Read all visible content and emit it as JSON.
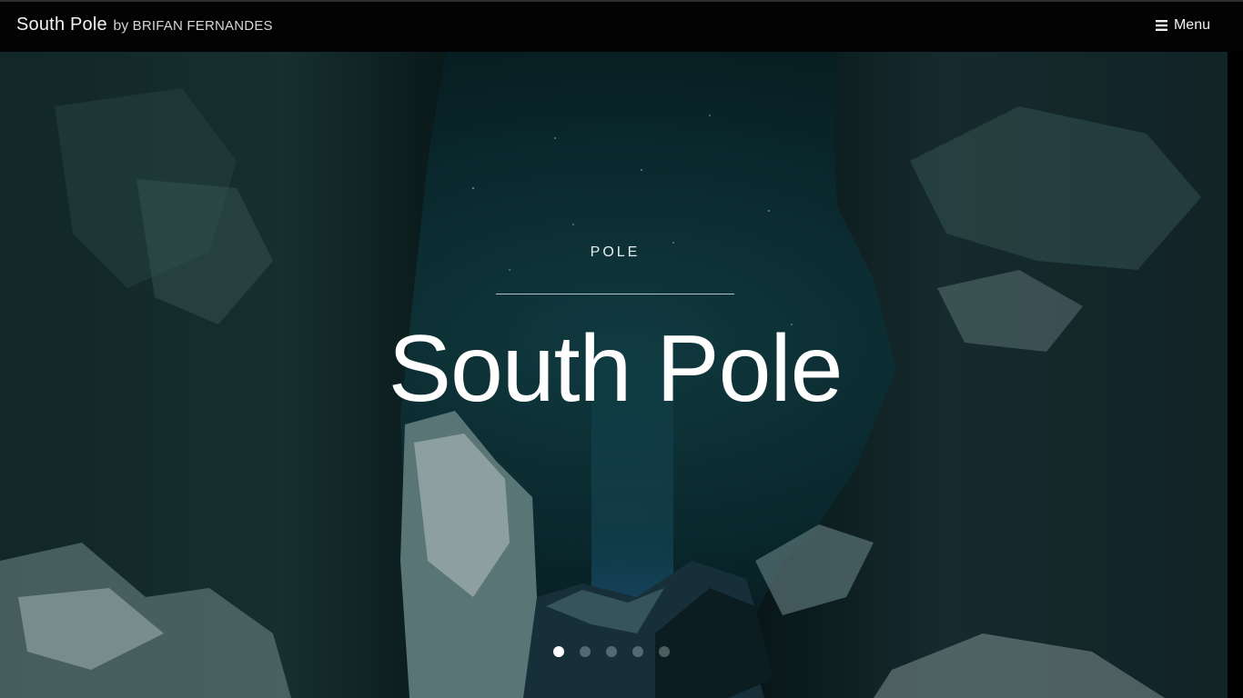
{
  "navbar": {
    "brand_name": "South Pole",
    "brand_by": "by",
    "brand_author": "BRIFAN FERNANDES",
    "menu_label": "Menu",
    "menu_icon": "hamburger-icon"
  },
  "hero": {
    "eyebrow": "POLE",
    "title": "South Pole",
    "slides": {
      "count": 5,
      "active_index": 1
    }
  },
  "colors": {
    "navbar_bg": "#030303",
    "text": "#ffffff",
    "sky": "#0e3a41",
    "rock": "#0f2226"
  }
}
